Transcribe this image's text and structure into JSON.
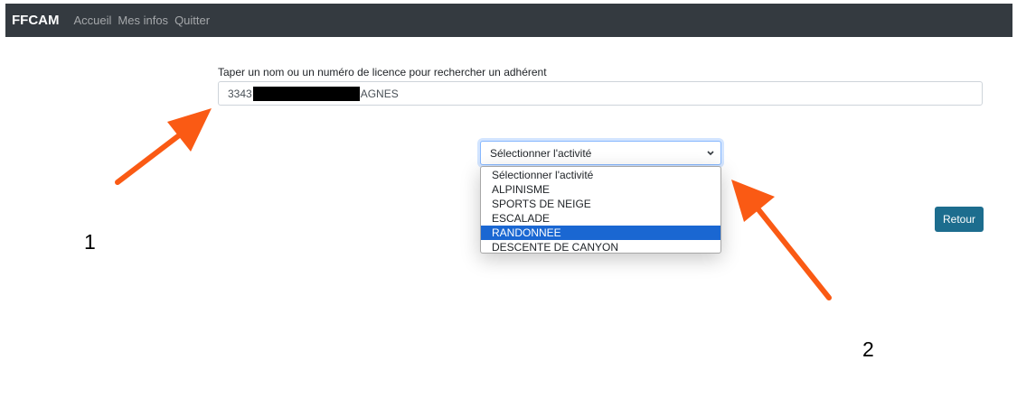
{
  "navbar": {
    "brand": "FFCAM",
    "links": [
      "Accueil",
      "Mes infos",
      "Quitter"
    ]
  },
  "search": {
    "label": "Taper un nom ou un numéro de licence pour rechercher un adhérent",
    "value_prefix": "3343",
    "value_suffix": "AGNES"
  },
  "activity_select": {
    "selected_value": "Sélectionner l'activité",
    "options": [
      "Sélectionner l'activité",
      "ALPINISME",
      "SPORTS DE NEIGE",
      "ESCALADE",
      "RANDONNEE",
      "DESCENTE DE CANYON"
    ],
    "highlighted_option": "RANDONNEE"
  },
  "retour_button": {
    "label": "Retour"
  },
  "annotations": {
    "label_1": "1",
    "label_2": "2",
    "arrow_color": "#fa5a14"
  },
  "colors": {
    "navbar_bg": "#343a40",
    "retour_bg": "#1d6d8e",
    "highlight_bg": "#1a67d2"
  }
}
